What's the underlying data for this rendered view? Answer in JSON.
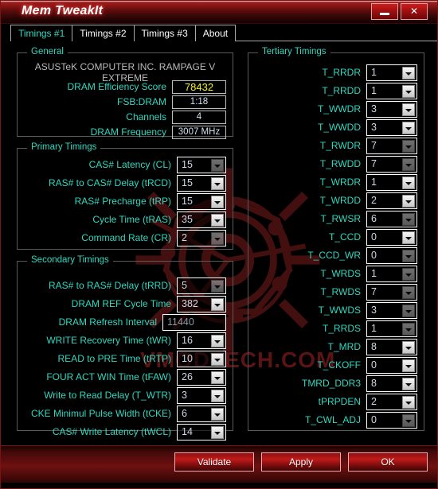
{
  "window": {
    "title": "Mem TweakIt",
    "minimize_label": "minimize",
    "close_label": "✕"
  },
  "tabs": [
    {
      "label": "Timings #1",
      "active": true
    },
    {
      "label": "Timings #2",
      "active": false
    },
    {
      "label": "Timings #3",
      "active": false
    },
    {
      "label": "About",
      "active": false
    }
  ],
  "watermark": {
    "text": "VMODTECH.COM",
    "color": "#5a1414"
  },
  "colors": {
    "label": "#2fd8c0",
    "value": "#cfd8e6",
    "highlight": "#f3ef2a",
    "accent_red": "#c01a1a"
  },
  "general": {
    "group_label": "General",
    "board": "ASUSTeK COMPUTER INC. RAMPAGE V EXTREME",
    "rows": [
      {
        "label": "DRAM Efficiency Score",
        "value": "78432",
        "highlight": true
      },
      {
        "label": "FSB:DRAM",
        "value": "1:18",
        "highlight": false
      },
      {
        "label": "Channels",
        "value": "4",
        "highlight": false
      },
      {
        "label": "DRAM Frequency",
        "value": "3007 MHz",
        "highlight": false
      }
    ]
  },
  "primary": {
    "group_label": "Primary Timings",
    "rows": [
      {
        "label": "CAS# Latency (CL)",
        "value": "15",
        "dim": true
      },
      {
        "label": "RAS# to CAS# Delay (tRCD)",
        "value": "15",
        "dim": false
      },
      {
        "label": "RAS# Precharge (tRP)",
        "value": "15",
        "dim": false
      },
      {
        "label": "Cycle Time (tRAS)",
        "value": "35",
        "dim": false
      },
      {
        "label": "Command Rate (CR)",
        "value": "2",
        "dim": true
      }
    ]
  },
  "secondary": {
    "group_label": "Secondary Timings",
    "rows": [
      {
        "label": "RAS# to RAS# Delay (tRRD)",
        "value": "5",
        "dim": true,
        "arrow": true
      },
      {
        "label": "DRAM REF Cycle Time",
        "value": "382",
        "dim": false,
        "arrow": true
      },
      {
        "label": "DRAM Refresh Interval",
        "value": "11440",
        "dim": false,
        "arrow": false
      },
      {
        "label": "WRITE Recovery Time (tWR)",
        "value": "16",
        "dim": false,
        "arrow": true
      },
      {
        "label": "READ to PRE Time (tRTP)",
        "value": "10",
        "dim": false,
        "arrow": true
      },
      {
        "label": "FOUR ACT WIN Time (tFAW)",
        "value": "26",
        "dim": false,
        "arrow": true
      },
      {
        "label": "Write to Read Delay (T_WTR)",
        "value": "3",
        "dim": false,
        "arrow": true
      },
      {
        "label": "CKE Minimul Pulse Width (tCKE)",
        "value": "6",
        "dim": false,
        "arrow": true
      },
      {
        "label": "CAS# Write Latency (tWCL)",
        "value": "14",
        "dim": false,
        "arrow": true
      }
    ]
  },
  "tertiary": {
    "group_label": "Tertiary Timings",
    "rows": [
      {
        "label": "T_RRDR",
        "value": "1",
        "dim": false
      },
      {
        "label": "T_RRDD",
        "value": "1",
        "dim": false
      },
      {
        "label": "T_WWDR",
        "value": "3",
        "dim": false
      },
      {
        "label": "T_WWDD",
        "value": "3",
        "dim": false
      },
      {
        "label": "T_RWDR",
        "value": "7",
        "dim": true
      },
      {
        "label": "T_RWDD",
        "value": "7",
        "dim": true
      },
      {
        "label": "T_WRDR",
        "value": "1",
        "dim": false
      },
      {
        "label": "T_WRDD",
        "value": "2",
        "dim": false
      },
      {
        "label": "T_RWSR",
        "value": "6",
        "dim": true
      },
      {
        "label": "T_CCD",
        "value": "0",
        "dim": false
      },
      {
        "label": "T_CCD_WR",
        "value": "0",
        "dim": true
      },
      {
        "label": "T_WRDS",
        "value": "1",
        "dim": true
      },
      {
        "label": "T_RWDS",
        "value": "7",
        "dim": true
      },
      {
        "label": "T_WWDS",
        "value": "3",
        "dim": true
      },
      {
        "label": "T_RRDS",
        "value": "1",
        "dim": true
      },
      {
        "label": "T_MRD",
        "value": "8",
        "dim": false
      },
      {
        "label": "T_CKOFF",
        "value": "0",
        "dim": false
      },
      {
        "label": "TMRD_DDR3",
        "value": "8",
        "dim": false
      },
      {
        "label": "tPRPDEN",
        "value": "2",
        "dim": false
      },
      {
        "label": "T_CWL_ADJ",
        "value": "0",
        "dim": true
      }
    ]
  },
  "footer": {
    "buttons": [
      {
        "label": "Validate"
      },
      {
        "label": "Apply"
      },
      {
        "label": "OK"
      }
    ]
  }
}
